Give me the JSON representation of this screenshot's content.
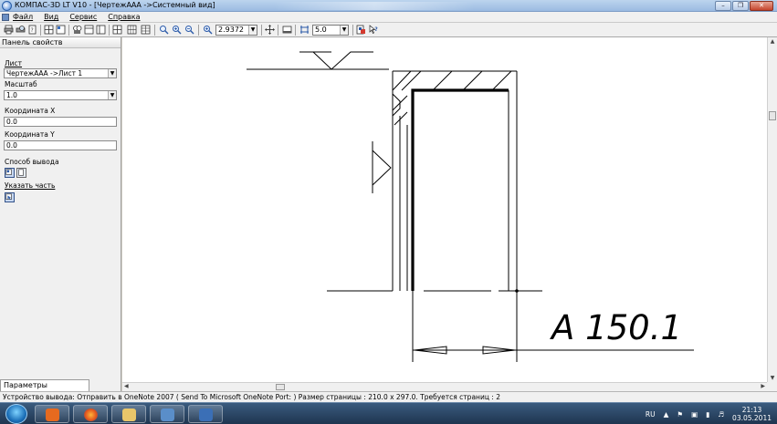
{
  "window": {
    "title": "КОМПАС-3D LT V10 - [ЧертежААА ->Системный вид]",
    "controls": [
      "minimize-icon",
      "restore-icon",
      "close-icon"
    ]
  },
  "menu": {
    "items": [
      "Файл",
      "Вид",
      "Сервис",
      "Справка"
    ]
  },
  "toolbar": {
    "zoom_value": "2.9372",
    "step_value": "5.0",
    "icons": [
      "print-icon",
      "print-preview-icon",
      "page-setup-icon",
      "layout-icon",
      "layout-2-icon",
      "find-icon",
      "sheet-icon",
      "sheet-2-icon",
      "zoom-fit-icon",
      "zoom-in-icon",
      "zoom-out-icon",
      "zoom-scale-icon",
      "pan-icon",
      "window-icon",
      "grid-icon",
      "export-icon",
      "help-icon"
    ]
  },
  "panel": {
    "header": "Панель свойств",
    "sheet_label": "Лист",
    "sheet_value": "ЧертежААА ->Лист 1",
    "scale_label": "Масштаб",
    "scale_value": "1.0",
    "coord_x_label": "Координата X",
    "coord_x_value": "0.0",
    "coord_y_label": "Координата Y",
    "coord_y_value": "0.0",
    "output_label": "Способ вывода",
    "part_label": "Указать часть",
    "tab_label": "Параметры просмотра"
  },
  "drawing": {
    "dimension_text": "A 150.1"
  },
  "status": {
    "text": "Устройство вывода: Отправить в OneNote 2007 ( Send To Microsoft OneNote Port: )  Размер страницы : 210.0 x 297.0.  Требуется страниц : 2"
  },
  "taskbar": {
    "apps": [
      "media-player",
      "firefox",
      "explorer",
      "virtualbox",
      "kompas"
    ],
    "language": "RU",
    "time": "21:13",
    "date": "03.05.2011"
  }
}
